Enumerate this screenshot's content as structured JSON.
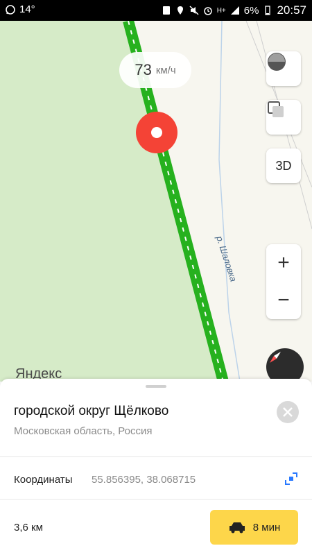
{
  "status_bar": {
    "temperature": "14°",
    "battery": "6%",
    "time": "20:57",
    "network": "H+"
  },
  "map": {
    "speed_value": "73",
    "speed_unit": "км/ч",
    "river_label": "р. Шаловка",
    "provider_logo": "Яндекс",
    "btn_3d": "3D",
    "zoom_in": "+",
    "zoom_out": "−"
  },
  "sheet": {
    "title": "городской округ Щёлково",
    "subtitle": "Московская область, Россия",
    "coordinates_label": "Координаты",
    "coordinates_value": "55.856395, 38.068715",
    "distance": "3,6 км",
    "route_time": "8 мин"
  },
  "colors": {
    "route_green": "#26b11e",
    "pin_red": "#f44336",
    "route_button": "#fdd64a",
    "forest": "#d6ebc8"
  }
}
